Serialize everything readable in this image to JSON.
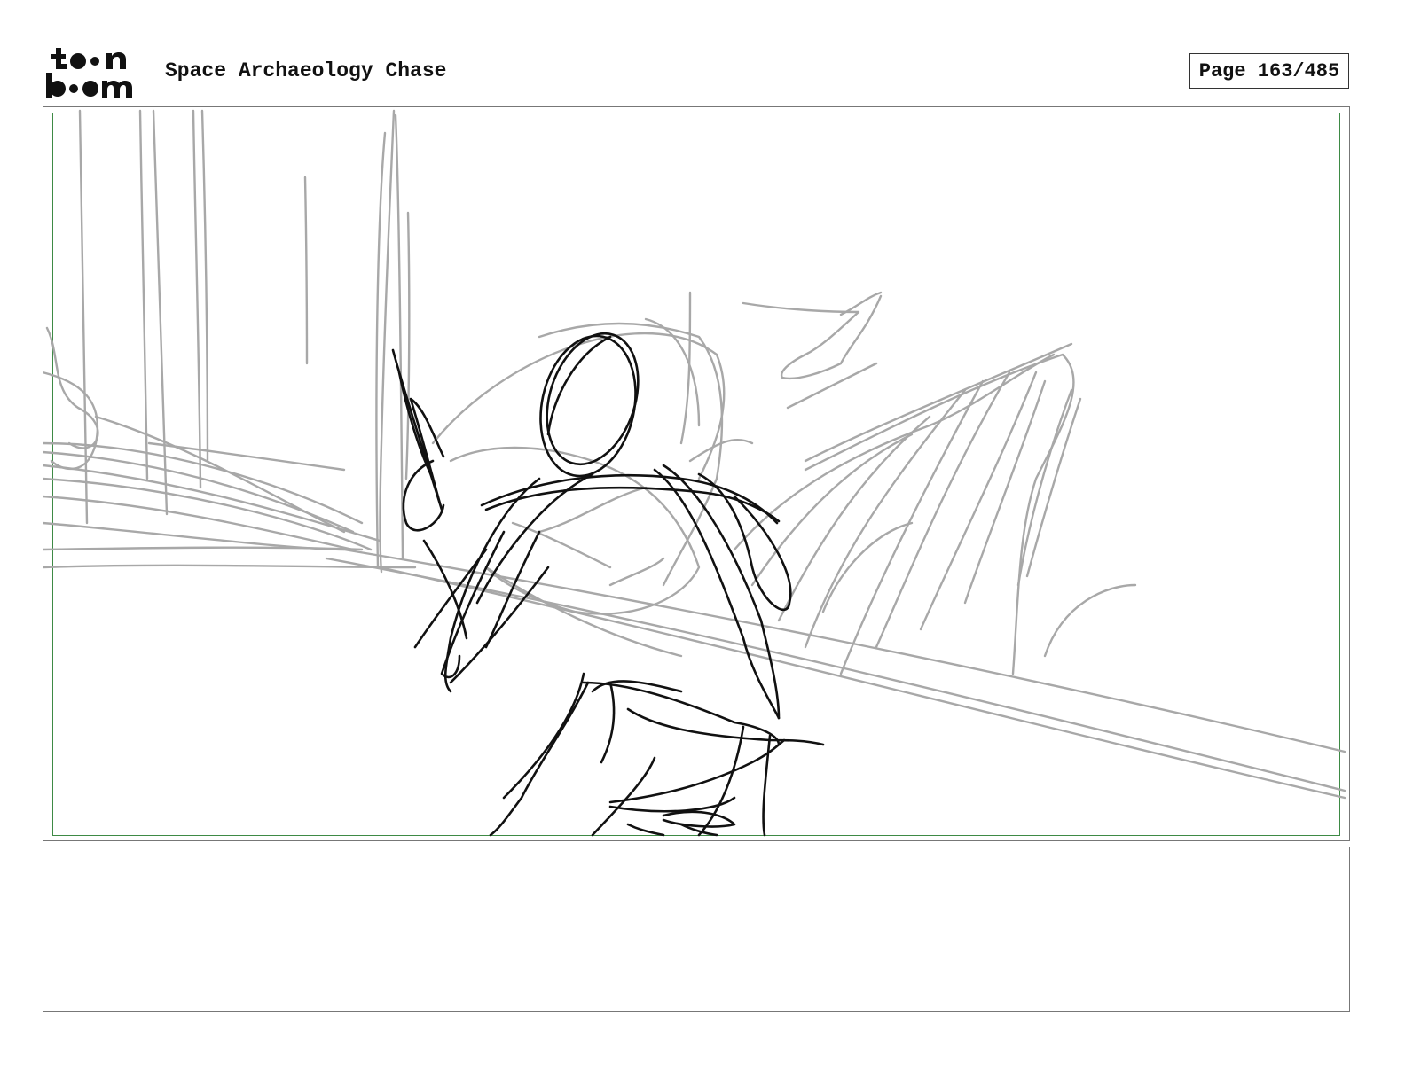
{
  "header": {
    "logo_top": "t••n",
    "logo_bottom": "b••m",
    "project_title": "Space Archaeology Chase",
    "page_indicator": "Page 163/485"
  },
  "panel": {
    "sketch_name": "storyboard-sketch"
  },
  "notes": {
    "dialog": ""
  },
  "colors": {
    "safe_frame": "#3e8a45",
    "rough_lines": "#a8a8a8",
    "ink_lines": "#111111"
  }
}
